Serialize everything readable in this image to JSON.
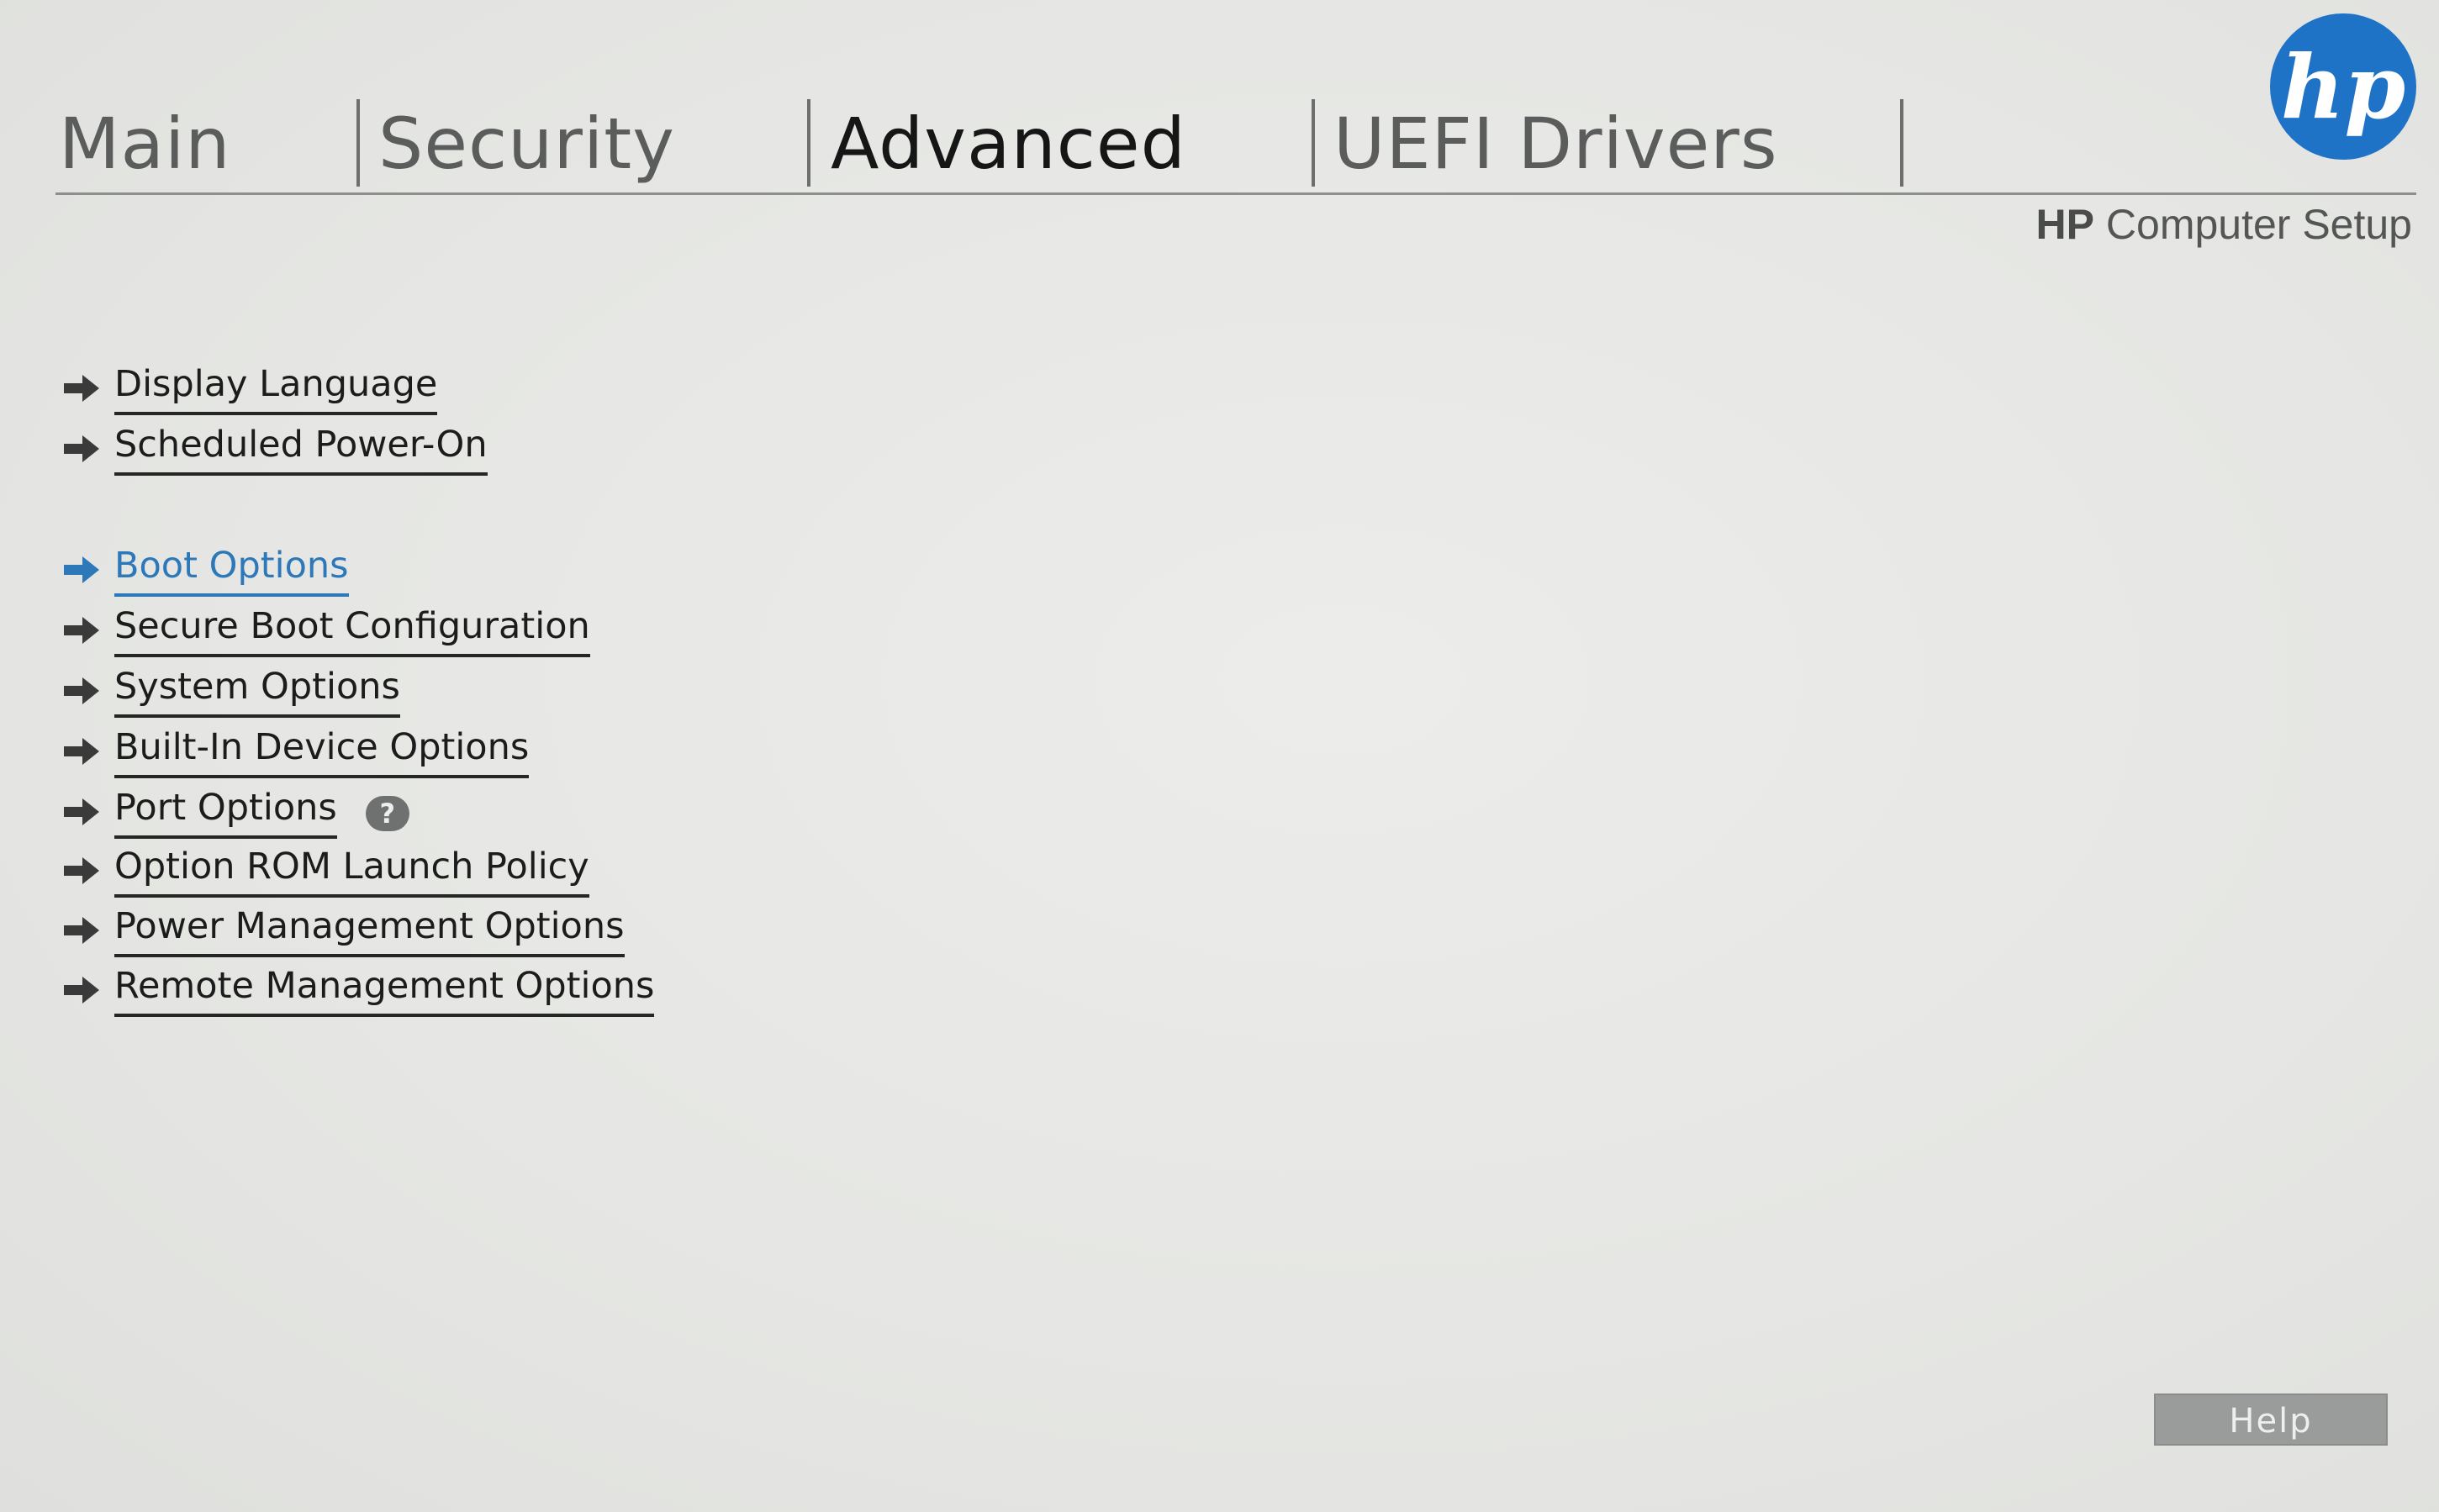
{
  "tabs": [
    {
      "label": "Main",
      "active": false
    },
    {
      "label": "Security",
      "active": false
    },
    {
      "label": "Advanced",
      "active": true
    },
    {
      "label": "UEFI Drivers",
      "active": false
    }
  ],
  "brand": {
    "logo_text": "hp",
    "title_bold": "HP",
    "title_rest": " Computer Setup",
    "logo_color": "#1f73c6"
  },
  "menu": {
    "items": [
      {
        "label": "Display Language"
      },
      {
        "label": "Scheduled Power-On"
      },
      {
        "label": "Boot Options",
        "selected": true
      },
      {
        "label": "Secure Boot Configuration"
      },
      {
        "label": "System Options"
      },
      {
        "label": "Built-In Device Options"
      },
      {
        "label": "Port Options",
        "help_badge": "?"
      },
      {
        "label": "Option ROM Launch Policy"
      },
      {
        "label": "Power Management Options"
      },
      {
        "label": "Remote Management Options"
      }
    ],
    "selected_color": "#2c78b9"
  },
  "footer": {
    "help_label": "Help"
  },
  "icons": {
    "menu_arrow": "arrow-right-icon",
    "logo": "hp-logo-icon",
    "help_badge": "question-mark-icon"
  }
}
